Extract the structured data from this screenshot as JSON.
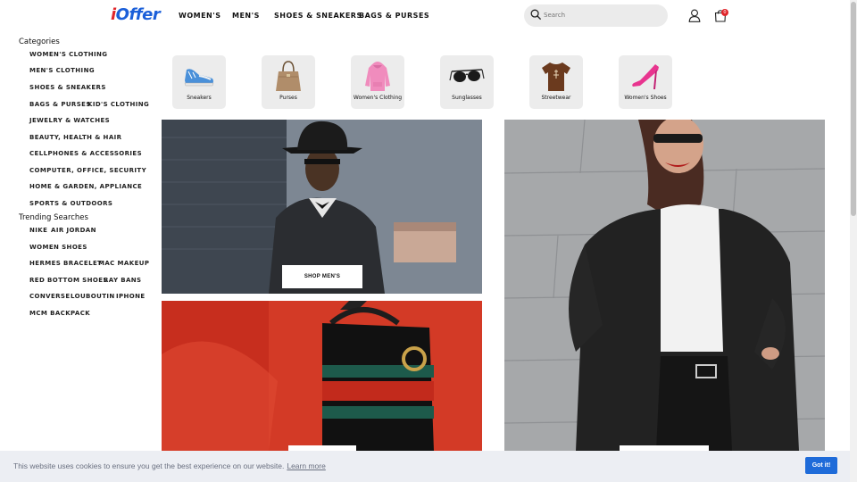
{
  "header": {
    "logo": "iOffer",
    "nav": [
      "WOMEN'S",
      "MEN'S",
      "SHOES & SNEAKERS",
      "BAGS & PURSES"
    ],
    "search_placeholder": "Search",
    "cart_count": "0"
  },
  "sidebar": {
    "categories_title": "Categories",
    "categories": [
      "WOMEN'S CLOTHING",
      "MEN'S CLOTHING",
      "SHOES & SNEAKERS",
      "BAGS & PURSES",
      "KID'S CLOTHING",
      "JEWELRY & WATCHES",
      "BEAUTY, HEALTH & HAIR",
      "CELLPHONES & ACCESSORIES",
      "COMPUTER, OFFICE, SECURITY",
      "HOME & GARDEN, APPLIANCE",
      "SPORTS & OUTDOORS"
    ],
    "trending_title": "Trending Searches",
    "trending": [
      "NIKE",
      "AIR JORDAN",
      "WOMEN SHOES",
      "HERMES BRACELET",
      "MAC MAKEUP",
      "RED BOTTOM SHOES",
      "RAY BANS",
      "CONVERSE",
      "LOUBOUTIN",
      "IPHONE",
      "MCM BACKPACK"
    ]
  },
  "tiles": [
    {
      "label": "Sneakers",
      "icon": "sneaker-icon"
    },
    {
      "label": "Purses",
      "icon": "purse-icon"
    },
    {
      "label": "Women's Clothing",
      "icon": "hoodie-icon"
    },
    {
      "label": "Sunglasses",
      "icon": "sunglasses-icon"
    },
    {
      "label": "Streetwear",
      "icon": "tshirt-icon"
    },
    {
      "label": "Women's Shoes",
      "icon": "heel-icon"
    }
  ],
  "banners": {
    "mens_button": "SHOP MEN'S"
  },
  "cookie": {
    "text": "This website uses cookies to ensure you get the best experience on our website.",
    "learn_more": "Learn more",
    "button": "Got it!"
  }
}
